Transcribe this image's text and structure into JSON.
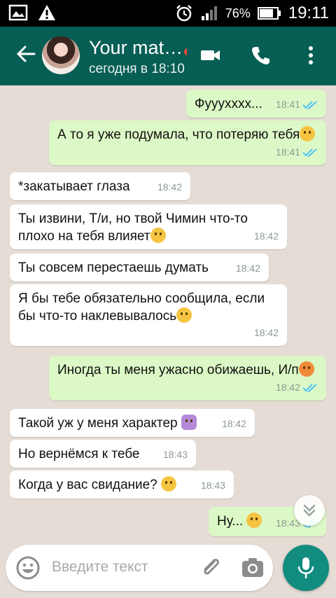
{
  "status_bar": {
    "battery_percent": "76%",
    "time": "19:11"
  },
  "header": {
    "contact_name": "Your mat…🎸",
    "last_seen": "сегодня в 18:10"
  },
  "messages": [
    {
      "dir": "out",
      "text": "Фуууххxx...",
      "time": "18:41",
      "read": true
    },
    {
      "dir": "out",
      "text": "А то я уже подумала, что потеряю тебя",
      "time": "18:41",
      "read": true
    },
    {
      "dir": "in",
      "text": "*закатывает глаза",
      "time": "18:42"
    },
    {
      "dir": "in",
      "text": "Ты извини, Т/и, но твой Чимин что-то плохо на тебя влияет",
      "time": "18:42"
    },
    {
      "dir": "in",
      "text": "Ты совсем перестаешь думать",
      "time": "18:42"
    },
    {
      "dir": "in",
      "text": "Я бы тебе обязательно сообщила, если бы что-то наклевывалось",
      "time": "18:42"
    },
    {
      "dir": "out",
      "text": "Иногда ты меня ужасно обижаешь, И/п",
      "time": "18:42",
      "read": true
    },
    {
      "dir": "in",
      "text": "Такой уж у меня характер",
      "time": "18:42"
    },
    {
      "dir": "in",
      "text": "Но вернёмся к тебе",
      "time": "18:43"
    },
    {
      "dir": "in",
      "text": "Когда у вас свидание?",
      "time": "18:43"
    },
    {
      "dir": "out",
      "text": "Ну...",
      "time": "18:43",
      "read": true
    }
  ],
  "composer": {
    "placeholder": "Введите текст"
  },
  "colors": {
    "header": "#075e54",
    "outgoing_bubble": "#dcf8c6",
    "incoming_bubble": "#ffffff",
    "read_tick": "#4fc3f7",
    "mic_button": "#128c7e"
  },
  "icons": [
    "gallery-icon",
    "warning-icon",
    "alarm-icon",
    "signal-icon",
    "battery-icon",
    "back-arrow-icon",
    "video-call-icon",
    "phone-icon",
    "more-vert-icon",
    "emoji-icon",
    "attach-icon",
    "camera-icon",
    "mic-icon",
    "chevron-double-down-icon"
  ]
}
